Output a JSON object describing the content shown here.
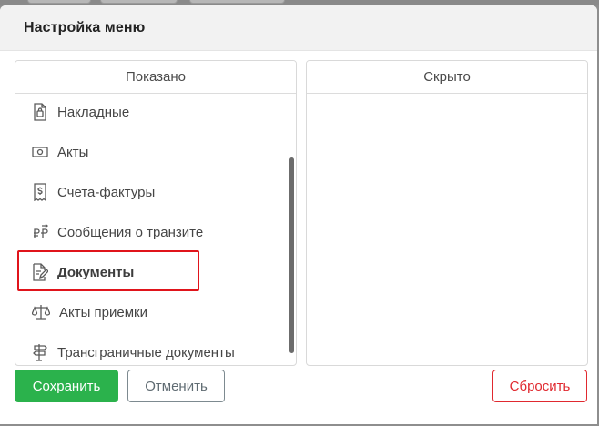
{
  "dialog": {
    "title": "Настройка меню"
  },
  "shown": {
    "header": "Показано",
    "items": [
      {
        "label": "Накладные",
        "icon": "invoice-bag-icon"
      },
      {
        "label": "Акты",
        "icon": "banknote-icon"
      },
      {
        "label": "Счета-фактуры",
        "icon": "dollar-receipt-icon"
      },
      {
        "label": "Сообщения о транзите",
        "icon": "ruble-transfer-icon"
      },
      {
        "label": "Документы",
        "icon": "document-edit-icon"
      },
      {
        "label": "Акты приемки",
        "icon": "scales-icon"
      },
      {
        "label": "Трансграничные документы",
        "icon": "signpost-icon"
      }
    ]
  },
  "hidden": {
    "header": "Скрыто",
    "items": []
  },
  "buttons": {
    "save": "Сохранить",
    "cancel": "Отменить",
    "reset": "Сбросить"
  },
  "colors": {
    "save_bg": "#2bb24c",
    "reset_accent": "#e0292f",
    "highlight": "#e0141b"
  }
}
